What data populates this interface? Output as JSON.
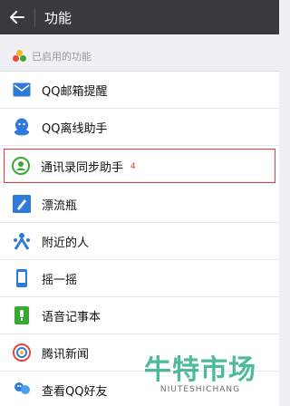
{
  "header": {
    "title": "功能",
    "back_icon": "arrow-left-icon"
  },
  "section": {
    "title": "已启用的功能"
  },
  "items": [
    {
      "label": "QQ邮箱提醒",
      "icon": "mail-icon",
      "color": "#2f7ad8"
    },
    {
      "label": "QQ离线助手",
      "icon": "qq-icon",
      "color": "#2f7ad8"
    },
    {
      "label": "通讯录同步助手",
      "icon": "contacts-sync-icon",
      "color": "#3aa934",
      "annotation": "4"
    },
    {
      "label": "漂流瓶",
      "icon": "bottle-icon",
      "color": "#2f7ad8"
    },
    {
      "label": "附近的人",
      "icon": "people-icon",
      "color": "#2f7ad8"
    },
    {
      "label": "摇一摇",
      "icon": "shake-phone-icon",
      "color": "#2f7ad8"
    },
    {
      "label": "语音记事本",
      "icon": "voice-note-icon",
      "color": "#3aa934"
    },
    {
      "label": "腾讯新闻",
      "icon": "news-icon",
      "color": "#e8483a"
    },
    {
      "label": "查看QQ好友",
      "icon": "qq-friends-icon",
      "color": "#2f7ad8"
    }
  ],
  "watermark": {
    "cn": "牛特市场",
    "en": "NIUTESHICHANG"
  }
}
